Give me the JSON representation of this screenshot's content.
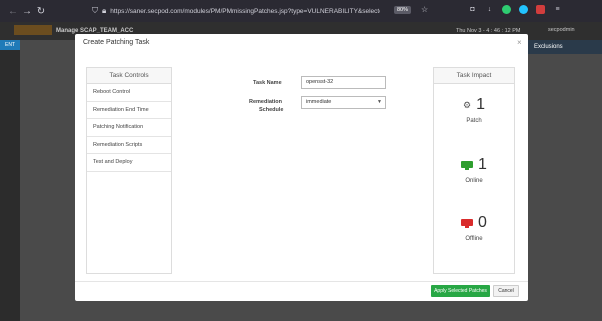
{
  "browser": {
    "url": "https://saner.secpod.com/modules/PM/PMmissingPatches.jsp?type=VULNERABILITY&selecte",
    "zoom": "80%"
  },
  "app": {
    "title": "Manage   SCAP_TEAM_ACC",
    "date": "Thu Nov 3 - 4 : 46 : 12 PM",
    "user": "secpodmin",
    "exclusions": "Exclusions",
    "sidebar_tab": "ENT"
  },
  "modal": {
    "title": "Create Patching Task",
    "close": "×",
    "controls": {
      "header": "Task Controls",
      "items": [
        "Reboot Control",
        "Remediation End Time",
        "Patching Notification",
        "Remediation Scripts",
        "Test and Deploy"
      ]
    },
    "form": {
      "task_name_label": "Task Name",
      "task_name_value": "opensst-32",
      "schedule_label_line1": "Remediation",
      "schedule_label_line2": "Schedule",
      "schedule_value": "immediate"
    },
    "impact": {
      "header": "Task Impact",
      "patch_count": "1",
      "patch_label": "Patch",
      "online_count": "1",
      "online_label": "Online",
      "offline_count": "0",
      "offline_label": "Offline"
    },
    "footer": {
      "apply_label": "Apply Selected Patches",
      "cancel_label": "Cancel"
    }
  },
  "colors": {
    "online": "#2e9e2e",
    "offline": "#d92b2b",
    "apply": "#28a745"
  },
  "icons": [
    "back-icon",
    "forward-icon",
    "reload-icon",
    "shield-icon",
    "lock-icon",
    "star-icon",
    "gear-icon",
    "monitor-icon"
  ]
}
